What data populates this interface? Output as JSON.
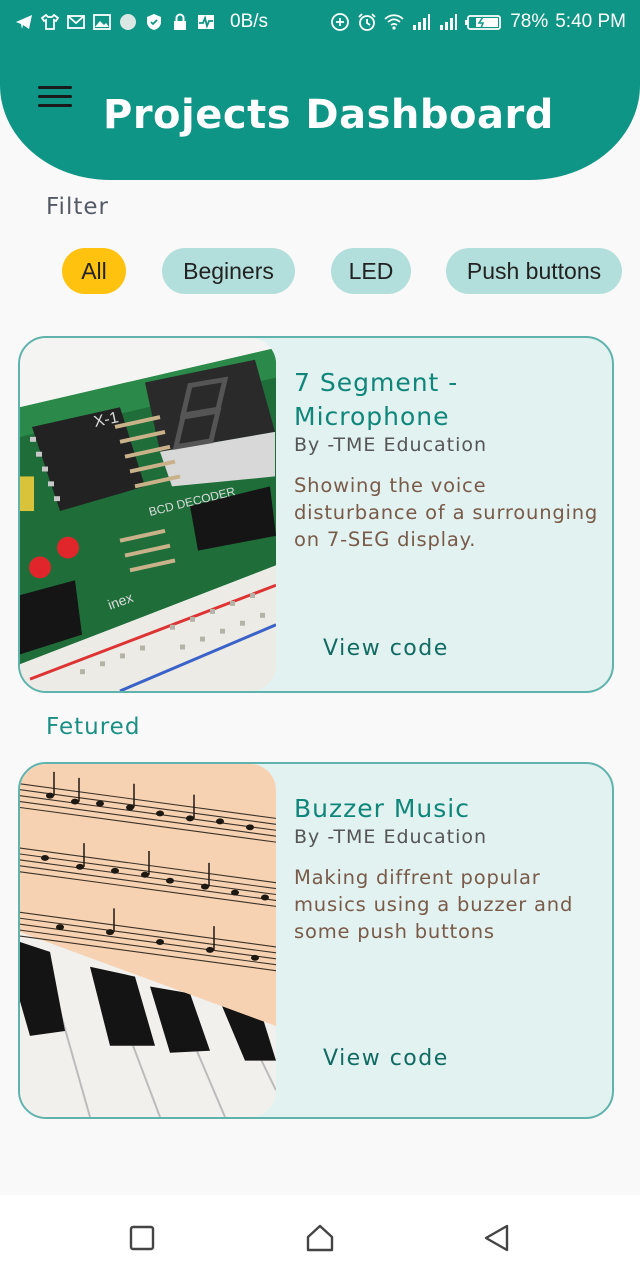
{
  "status_bar": {
    "network_speed": "0B/s",
    "battery_percent": "78%",
    "time": "5:40 PM",
    "left_icons": [
      "telegram-icon",
      "shirt-icon",
      "gmail-icon",
      "gallery-icon",
      "circle-icon",
      "shield-icon",
      "lock-icon",
      "activity-icon"
    ],
    "right_icons": [
      "data-saver-icon",
      "alarm-icon",
      "wifi-icon",
      "signal-icon",
      "signal-icon",
      "battery-charging-icon"
    ]
  },
  "header": {
    "title": "Projects Dashboard",
    "menu_icon": "hamburger-menu-icon",
    "color": "#0e9585"
  },
  "filter": {
    "label": "Filter",
    "chips": [
      {
        "label": "All",
        "active": true
      },
      {
        "label": "Beginers",
        "active": false
      },
      {
        "label": "LED",
        "active": false
      },
      {
        "label": "Push buttons",
        "active": false
      }
    ],
    "active_color": "#ffc20e",
    "chip_color": "#b2dfdb"
  },
  "cards": [
    {
      "title": "7 Segment - Microphone",
      "author": "By -TME Education",
      "description": "Showing the voice disturbance of a surrounging on 7-SEG display.",
      "action": "View code",
      "image": "7-segment-breadboard-image"
    }
  ],
  "featured": {
    "label": "Fetured",
    "cards": [
      {
        "title": "Buzzer Music",
        "author": "By -TME Education",
        "description": "Making diffrent popular musics using a buzzer and some push buttons",
        "action": "View code",
        "image": "sheet-music-piano-image"
      }
    ]
  },
  "navigation": {
    "buttons": [
      "recents-square-icon",
      "home-icon",
      "back-triangle-icon"
    ]
  }
}
